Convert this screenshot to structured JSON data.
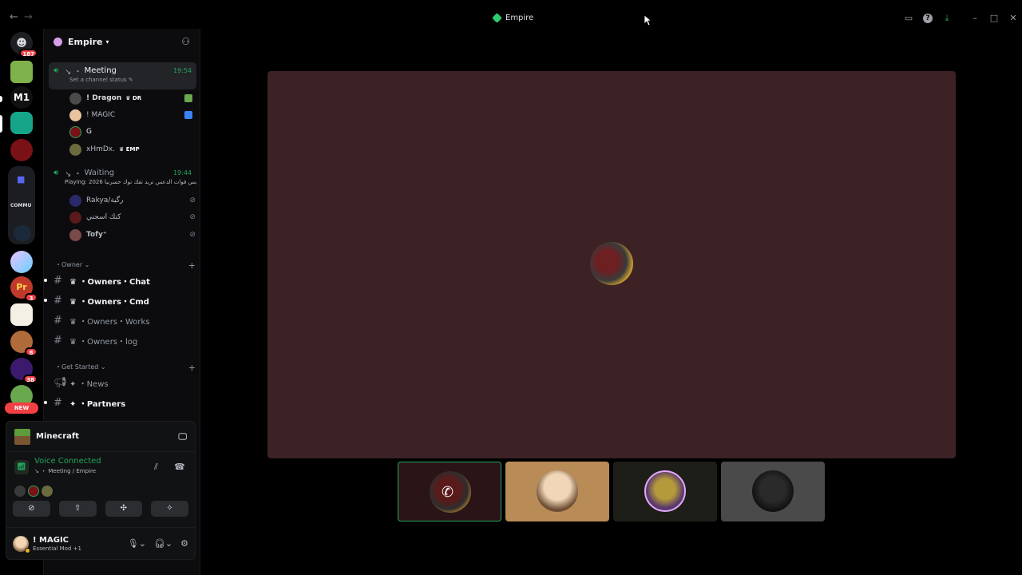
{
  "window": {
    "title": "Empire",
    "back_arrow": "←",
    "forward_arrow": "→",
    "icons": [
      "inbox-icon",
      "help-icon",
      "download-icon",
      "minimize-icon",
      "maximize-icon",
      "close-icon"
    ]
  },
  "rail": {
    "home_badge": "187",
    "badges": {
      "srv_pr": "3",
      "srv_person": "8",
      "srv_star": "38"
    },
    "folder_label": "COMMU",
    "new_label": "NEW"
  },
  "guild": {
    "name": "Empire"
  },
  "voice_channels": [
    {
      "name": "Meeting",
      "prefix": "↘ ・",
      "time": "19:54",
      "status_prompt": "Set a channel status",
      "members": [
        {
          "name": "! Dragon",
          "tag": "DR"
        },
        {
          "name": "! MAGIC",
          "tag": ""
        },
        {
          "name": "G",
          "tag": ""
        },
        {
          "name": "xHmDx.",
          "tag": "EMP"
        }
      ]
    },
    {
      "name": "Waiting",
      "prefix": "↘ ・",
      "time": "19:44",
      "status_prompt": "Playing: 2026 بس فوات الدعس تريد تفك توك حسرنيا...",
      "members": [
        {
          "name": "Rakya/رگية"
        },
        {
          "name": "كنك اسجني"
        },
        {
          "name": "Tofy⁺"
        }
      ]
    }
  ],
  "categories": [
    {
      "name": "Owner",
      "channels": [
        {
          "icon": "♛",
          "name": "Owners・Chat",
          "unread": true
        },
        {
          "icon": "♛",
          "name": "Owners・Cmd",
          "unread": true
        },
        {
          "icon": "♛",
          "name": "Owners・Works",
          "unread": false
        },
        {
          "icon": "♛",
          "name": "Owners・log",
          "unread": false
        }
      ]
    },
    {
      "name": "Get Started",
      "channels": [
        {
          "icon": "✦",
          "name": "News",
          "unread": false
        },
        {
          "icon": "✦",
          "name": "Partners",
          "unread": true
        }
      ]
    }
  ],
  "activity": {
    "game": "Minecraft"
  },
  "voice_status": {
    "title": "Voice Connected",
    "location": "↘ ・ Meeting / Empire"
  },
  "user": {
    "name": "! MAGIC",
    "status": "Essential Mod +1"
  },
  "colors": {
    "stage_bg": "#3c2125",
    "accent_green": "#23a55a",
    "badge_red": "#f23f43"
  }
}
